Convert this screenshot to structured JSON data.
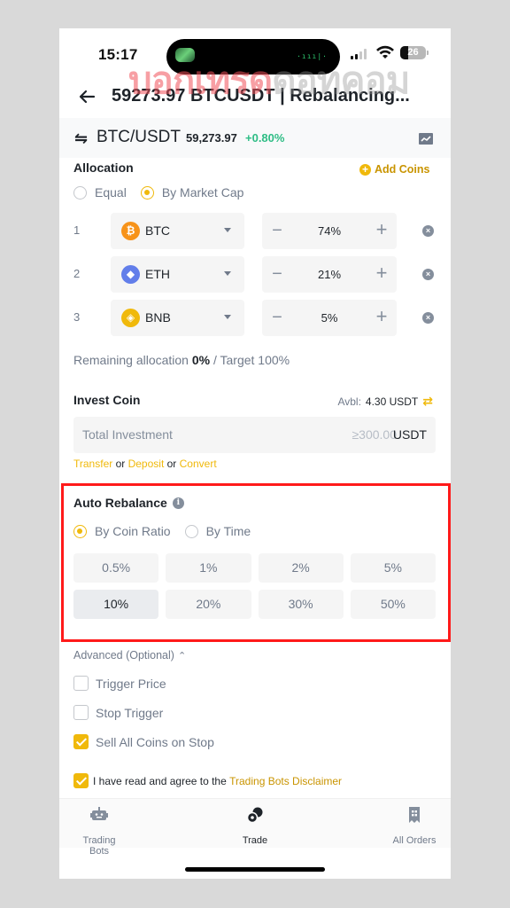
{
  "status_bar": {
    "time": "15:17",
    "battery": "26",
    "battery_level_percent": 26,
    "island_wave": "·ııı|·"
  },
  "watermark": {
    "part1": "บอกเทรด",
    "part2": "ดอทคอม"
  },
  "header": {
    "back_icon": "arrow-left-icon",
    "title": "59273.97 BTCUSDT | Rebalancing..."
  },
  "ticker": {
    "swap_icon": "⇋",
    "pair": "BTC/USDT",
    "price": "59,273.97",
    "change": "+0.80%",
    "change_color": "#2ebd85",
    "chart_icon": "chart-icon"
  },
  "allocation": {
    "label": "Allocation",
    "add_coins": "Add Coins",
    "modes": [
      {
        "label": "Equal",
        "selected": false
      },
      {
        "label": "By Market Cap",
        "selected": true
      }
    ],
    "coins": [
      {
        "index": "1",
        "symbol": "BTC",
        "icon_glyph": "₿",
        "icon_color": "#f7931a",
        "percent": "74%"
      },
      {
        "index": "2",
        "symbol": "ETH",
        "icon_glyph": "◆",
        "icon_color": "#627eea",
        "percent": "21%"
      },
      {
        "index": "3",
        "symbol": "BNB",
        "icon_glyph": "◈",
        "icon_color": "#f0b90b",
        "percent": "5%"
      }
    ],
    "minus": "−",
    "plus": "+",
    "remove": "×",
    "remaining_prefix": "Remaining allocation",
    "remaining_value": "0%",
    "target": "/ Target 100%"
  },
  "invest": {
    "label": "Invest Coin",
    "avbl_label": "Avbl:",
    "avbl_value": "4.30 USDT",
    "transfer_icon": "⇄",
    "placeholder": "Total Investment",
    "minimum": "≥300.00",
    "unit": "USDT",
    "links": {
      "transfer": "Transfer",
      "or1": "or",
      "deposit": "Deposit",
      "or2": "or",
      "convert": "Convert"
    }
  },
  "auto_rebalance": {
    "label": "Auto Rebalance",
    "info_icon": "i",
    "modes": [
      {
        "label": "By Coin Ratio",
        "selected": true
      },
      {
        "label": "By Time",
        "selected": false
      }
    ],
    "options": [
      {
        "label": "0.5%",
        "selected": false
      },
      {
        "label": "1%",
        "selected": false
      },
      {
        "label": "2%",
        "selected": false
      },
      {
        "label": "5%",
        "selected": false
      },
      {
        "label": "10%",
        "selected": true
      },
      {
        "label": "20%",
        "selected": false
      },
      {
        "label": "30%",
        "selected": false
      },
      {
        "label": "50%",
        "selected": false
      }
    ],
    "highlight_color": "#ff1a1a"
  },
  "advanced": {
    "label": "Advanced (Optional)",
    "chevron": "⌃",
    "options": [
      {
        "label": "Trigger Price",
        "checked": false
      },
      {
        "label": "Stop Trigger",
        "checked": false
      },
      {
        "label": "Sell All Coins on Stop",
        "checked": true
      }
    ]
  },
  "disclaimer": {
    "checked": true,
    "text": "I have read and agree to the",
    "link": "Trading Bots Disclaimer"
  },
  "bottom_nav": [
    {
      "label": "Trading Bots",
      "icon": "robot-icon",
      "active": false
    },
    {
      "label": "Trade",
      "icon": "trade-icon",
      "active": true
    },
    {
      "label": "All Orders",
      "icon": "orders-icon",
      "active": false
    }
  ],
  "colors": {
    "accent": "#f0b90b",
    "text": "#1e2329",
    "muted": "#707a8a",
    "positive": "#2ebd85"
  }
}
